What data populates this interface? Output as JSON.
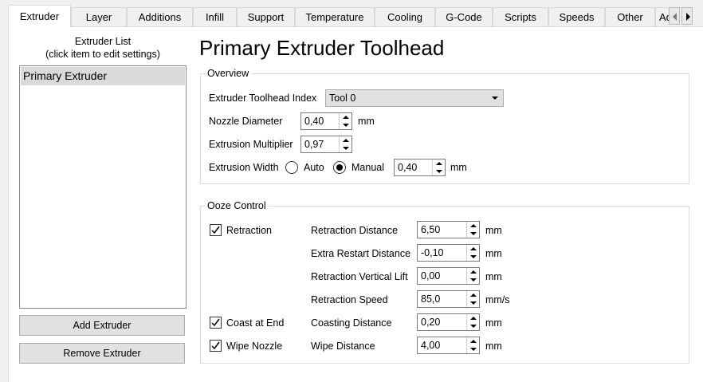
{
  "tabs": [
    {
      "label": "Extruder",
      "active": true
    },
    {
      "label": "Layer"
    },
    {
      "label": "Additions"
    },
    {
      "label": "Infill"
    },
    {
      "label": "Support"
    },
    {
      "label": "Temperature"
    },
    {
      "label": "Cooling"
    },
    {
      "label": "G-Code"
    },
    {
      "label": "Scripts"
    },
    {
      "label": "Speeds"
    },
    {
      "label": "Other"
    },
    {
      "label": "Ad"
    }
  ],
  "extruder_list": {
    "heading_line1": "Extruder List",
    "heading_line2": "(click item to edit settings)",
    "items": [
      "Primary Extruder"
    ],
    "add_button": "Add Extruder",
    "remove_button": "Remove Extruder"
  },
  "title": "Primary Extruder Toolhead",
  "overview": {
    "group_title": "Overview",
    "toolhead_index_label": "Extruder Toolhead Index",
    "toolhead_index_value": "Tool 0",
    "nozzle_diameter_label": "Nozzle Diameter",
    "nozzle_diameter_value": "0,40",
    "nozzle_diameter_unit": "mm",
    "extrusion_multiplier_label": "Extrusion Multiplier",
    "extrusion_multiplier_value": "0,97",
    "extrusion_width_label": "Extrusion Width",
    "auto_label": "Auto",
    "manual_label": "Manual",
    "extrusion_width_mode": "Manual",
    "extrusion_width_value": "0,40",
    "extrusion_width_unit": "mm"
  },
  "ooze": {
    "group_title": "Ooze Control",
    "retraction_label": "Retraction",
    "retraction_checked": true,
    "coast_label": "Coast at End",
    "coast_checked": true,
    "wipe_label": "Wipe Nozzle",
    "wipe_checked": true,
    "retraction_distance_label": "Retraction Distance",
    "retraction_distance_value": "6,50",
    "retraction_distance_unit": "mm",
    "extra_restart_label": "Extra Restart Distance",
    "extra_restart_value": "-0,10",
    "extra_restart_unit": "mm",
    "vertical_lift_label": "Retraction Vertical Lift",
    "vertical_lift_value": "0,00",
    "vertical_lift_unit": "mm",
    "retraction_speed_label": "Retraction Speed",
    "retraction_speed_value": "85,0",
    "retraction_speed_unit": "mm/s",
    "coasting_distance_label": "Coasting Distance",
    "coasting_distance_value": "0,20",
    "coasting_distance_unit": "mm",
    "wipe_distance_label": "Wipe Distance",
    "wipe_distance_value": "4,00",
    "wipe_distance_unit": "mm"
  }
}
